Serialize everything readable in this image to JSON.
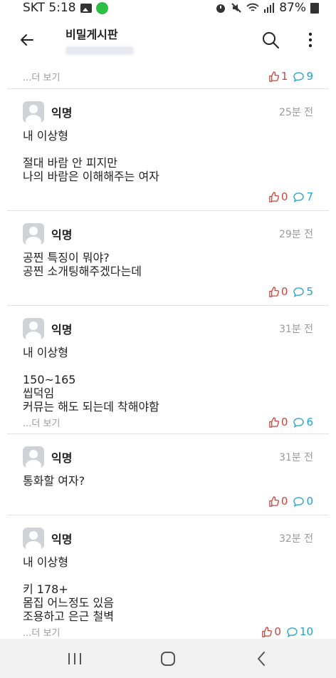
{
  "status": {
    "carrier_time": "SKT 5:18",
    "battery": "87%"
  },
  "header": {
    "title": "비밀게시판"
  },
  "top_partial": {
    "more": "...더 보기",
    "likes": "1",
    "comments": "9"
  },
  "posts": [
    {
      "author": "익명",
      "time": "25분 전",
      "body": "내 이상형\n\n절대 바람 안 피지만\n나의 바람은 이해해주는 여자",
      "more": "",
      "likes": "0",
      "comments": "7"
    },
    {
      "author": "익명",
      "time": "29분 전",
      "body": "공찐 특징이 뭐야?\n공찐 소개팅해주겠다는데",
      "more": "",
      "likes": "0",
      "comments": "5"
    },
    {
      "author": "익명",
      "time": "31분 전",
      "body": "내 이상형\n\n150~165\n씹덕임\n커뮤는 해도 되는데 착해야함",
      "more": "...더 보기",
      "likes": "0",
      "comments": "6"
    },
    {
      "author": "익명",
      "time": "31분 전",
      "body": "통화할 여자?",
      "more": "",
      "likes": "0",
      "comments": "0"
    },
    {
      "author": "익명",
      "time": "32분 전",
      "body": "내 이상형\n\n키 178+\n몸집 어느정도 있음\n조용하고 은근 철벽",
      "more": "...더 보기",
      "likes": "0",
      "comments": "10"
    }
  ],
  "icons": {
    "back": "arrow-left-icon",
    "search": "search-icon",
    "menu": "more-vertical-icon",
    "like": "thumbs-up-icon",
    "comment": "comment-bubble-icon"
  },
  "colors": {
    "like": "#c8453b",
    "comment": "#1fa3c9"
  }
}
